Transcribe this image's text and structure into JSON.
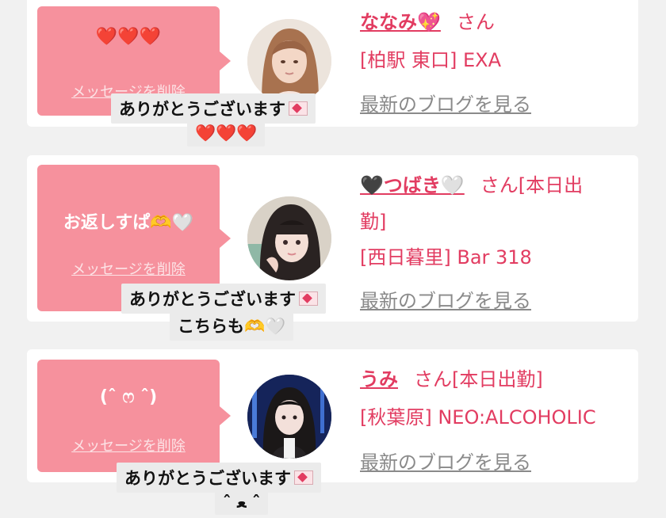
{
  "colors": {
    "page_bg": "#f1f1f1",
    "card_bg": "#ffffff",
    "bubble_pink": "#f6919d",
    "name_red": "#e23c61",
    "link_gray": "#8a8a8a",
    "tooltip_bg": "#ebebeb"
  },
  "messages": [
    {
      "bubble_text": "❤️❤️❤️",
      "delete_label": "メッセージを削除",
      "name": "ななみ💖",
      "honorific": "さん",
      "info_lines": [
        "[柏駅 東口] EXA"
      ],
      "blog_label": "最新のブログを見る",
      "tooltip_lines": [
        "ありがとうございます",
        "❤️❤️❤️"
      ],
      "tooltip_icon": "envelope-heart-icon",
      "avatar_icon": "profile-photo"
    },
    {
      "bubble_text": "お返しすぱ🫶🤍",
      "delete_label": "メッセージを削除",
      "name": "🖤つばき🤍",
      "honorific": "さん[本日出",
      "info_lines": [
        "勤]",
        "[西日暮里] Bar 318"
      ],
      "blog_label": "最新のブログを見る",
      "tooltip_lines": [
        "ありがとうございます",
        "こちらも🫶🤍"
      ],
      "tooltip_icon": "envelope-heart-icon",
      "avatar_icon": "profile-photo"
    },
    {
      "bubble_text": "(ˆ ෆ ˆ)",
      "delete_label": "メッセージを削除",
      "name": "うみ",
      "honorific": "さん[本日出勤]",
      "info_lines": [
        "[秋葉原] NEO:ALCOHOLIC"
      ],
      "blog_label": "最新のブログを見る",
      "tooltip_lines": [
        "ありがとうございます",
        "ˆ ﻌ ˆ"
      ],
      "tooltip_icon": "envelope-heart-icon",
      "avatar_icon": "profile-photo"
    }
  ]
}
